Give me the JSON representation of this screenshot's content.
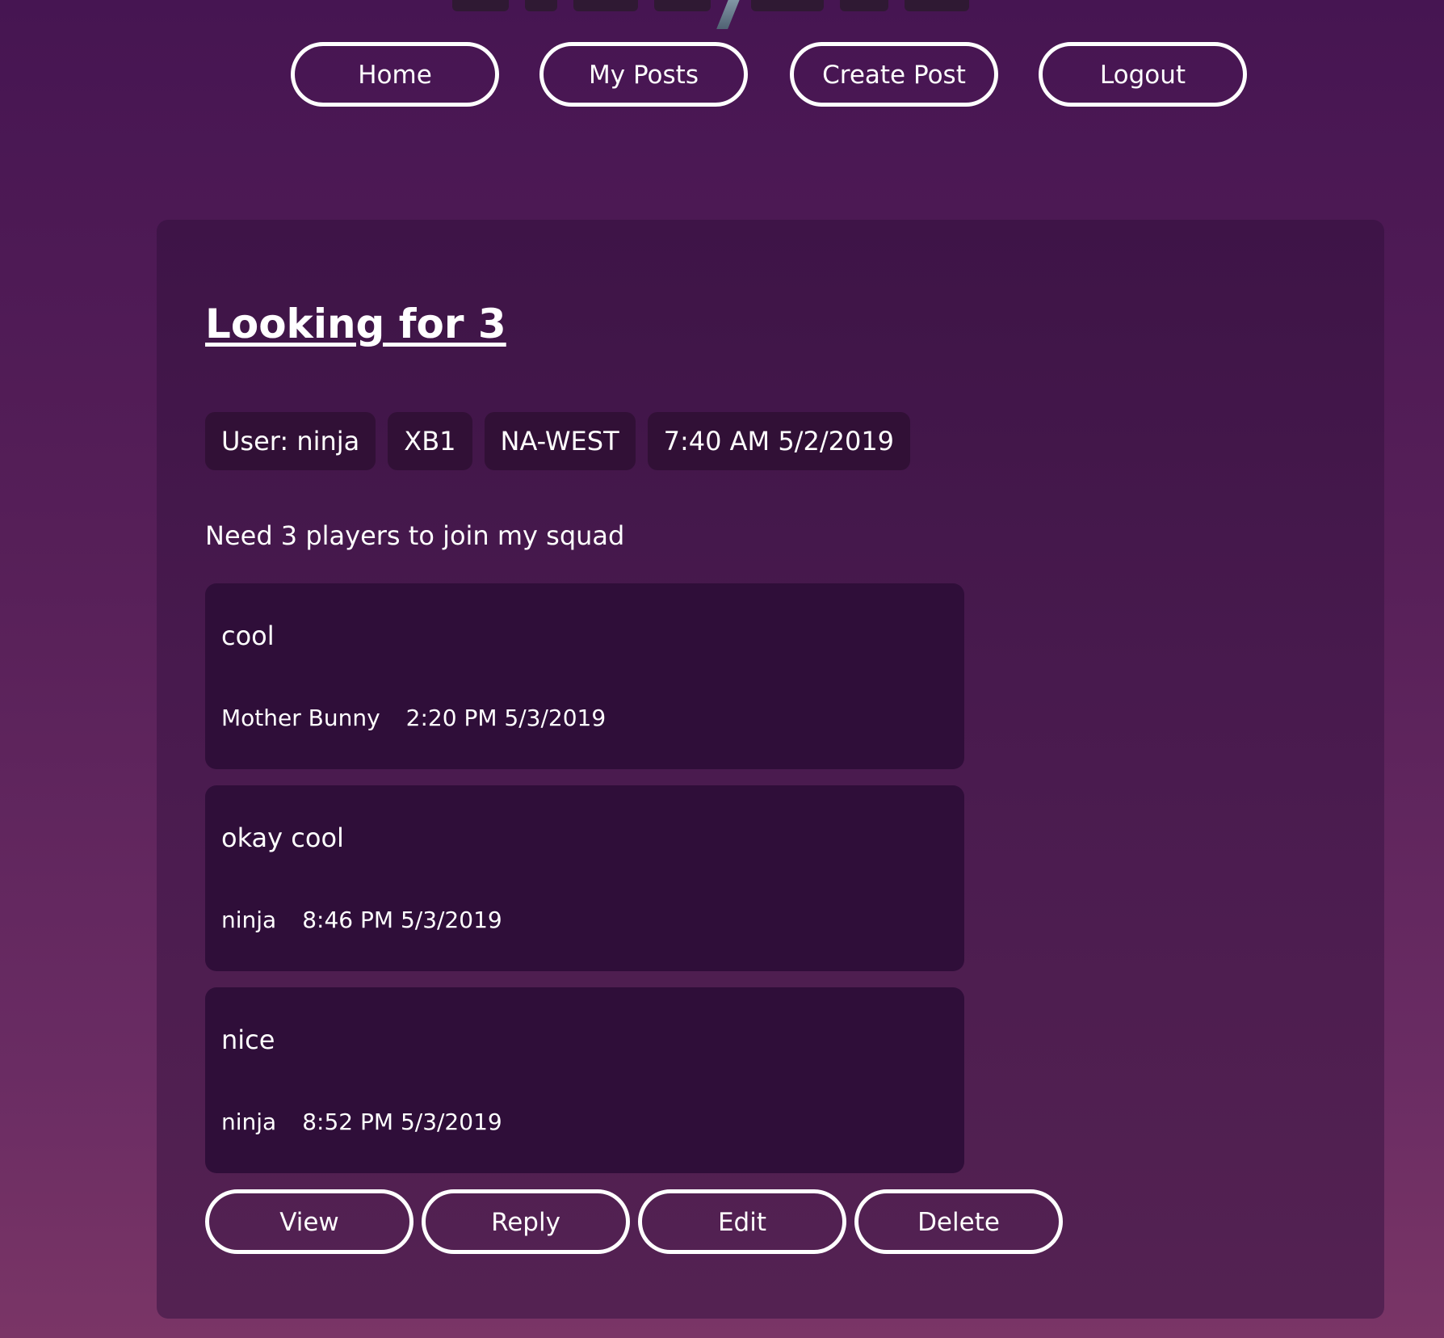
{
  "nav": {
    "home": "Home",
    "my_posts": "My Posts",
    "create_post": "Create Post",
    "logout": "Logout"
  },
  "post": {
    "title": "Looking for 3",
    "user": "User: ninja",
    "platform": "XB1",
    "region": "NA-WEST",
    "timestamp": "7:40 AM 5/2/2019",
    "body": "Need 3 players to join my squad"
  },
  "replies": [
    {
      "text": "cool",
      "author": "Mother Bunny",
      "time": "2:20 PM 5/3/2019"
    },
    {
      "text": "okay cool",
      "author": "ninja",
      "time": "8:46 PM 5/3/2019"
    },
    {
      "text": "nice",
      "author": "ninja",
      "time": "8:52 PM 5/3/2019"
    }
  ],
  "actions": {
    "view": "View",
    "reply": "Reply",
    "edit": "Edit",
    "delete": "Delete"
  },
  "colors": {
    "background_top": "#461552",
    "background_bottom": "#7a3566",
    "card": "#461950",
    "tag_and_reply": "#2f0e39",
    "text": "#ffffff"
  }
}
